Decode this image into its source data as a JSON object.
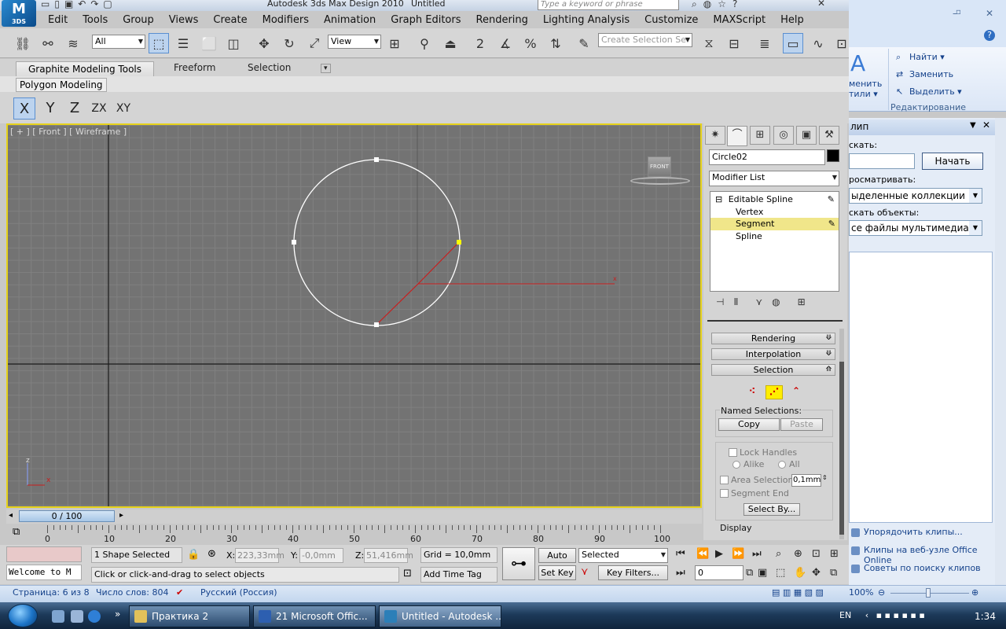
{
  "app": {
    "title": "Autodesk 3ds Max Design 2010",
    "doc_title": "Untitled",
    "logo_text": "3DS",
    "search_placeholder": "Type a keyword or phrase"
  },
  "menu": [
    "Edit",
    "Tools",
    "Group",
    "Views",
    "Create",
    "Modifiers",
    "Animation",
    "Graph Editors",
    "Rendering",
    "Lighting Analysis",
    "Customize",
    "MAXScript",
    "Help"
  ],
  "toolbar": {
    "selection_filter": "All",
    "ref_coord": "View",
    "named_selection_placeholder": "Create Selection Se"
  },
  "ribbon": {
    "tabs": [
      "Graphite Modeling Tools",
      "Freeform",
      "Selection"
    ],
    "panel_label": "Polygon Modeling",
    "axis_buttons": [
      "X",
      "Y",
      "Z",
      "ZX",
      "XY"
    ]
  },
  "viewport": {
    "label": "[ + ] [ Front ] [ Wireframe ]",
    "viewcube_label": "FRONT",
    "axis_z": "z",
    "axis_x": "x"
  },
  "command_panel": {
    "object_name": "Circle02",
    "modifier_list": "Modifier List",
    "stack": {
      "root": "Editable Spline",
      "items": [
        "Vertex",
        "Segment",
        "Spline"
      ]
    },
    "rollouts": [
      "Rendering",
      "Interpolation",
      "Selection"
    ],
    "named_selections_label": "Named Selections:",
    "copy_label": "Copy",
    "paste_label": "Paste",
    "lock_handles_label": "Lock Handles",
    "alike_label": "Alike",
    "all_label": "All",
    "area_selection_label": "Area Selection:",
    "area_selection_value": "0,1mm",
    "segment_end_label": "Segment End",
    "select_by_label": "Select By...",
    "display_label": "Display"
  },
  "timeline": {
    "slider_label": "0 / 100",
    "tick_labels": [
      "0",
      "10",
      "20",
      "30",
      "40",
      "50",
      "60",
      "70",
      "80",
      "90",
      "100"
    ]
  },
  "status": {
    "selection": "1 Shape Selected",
    "prompt": "Click or click-and-drag to select objects",
    "maxscript": "Welcome to M",
    "x_label": "X:",
    "x_value": "223,33mm",
    "y_label": "Y:",
    "y_value": "-0,0mm",
    "z_label": "Z:",
    "z_value": "51,416mm",
    "grid": "Grid = 10,0mm",
    "add_time_tag": "Add Time Tag",
    "auto_key": "Auto Key",
    "set_key": "Set Key",
    "key_mode": "Selected",
    "key_filters": "Key Filters...",
    "frame": "0"
  },
  "word": {
    "styles_lines": [
      "менить",
      "тили ▾"
    ],
    "find": "Найти ▾",
    "replace": "Заменить",
    "select": "Выделить ▾",
    "edit_group": "Редактирование",
    "clip_title": "лип",
    "search_label": "скать:",
    "go_button": "Начать",
    "browse_label": "росматривать:",
    "browse_value": "ыделенные коллекции",
    "find_objects_label": "скать объекты:",
    "find_objects_value": "се файлы мультимедиа",
    "links": [
      "Упорядочить клипы...",
      "Клипы на веб-узле Office Online",
      "Советы по поиску клипов"
    ],
    "status_page": "Страница: 6 из 8",
    "status_words": "Число слов: 804",
    "status_lang": "Русский (Россия)",
    "zoom": "100%"
  },
  "taskbar": {
    "items": [
      "Практика 2",
      "21 Microsoft Offic...",
      "Untitled - Autodesk ..."
    ],
    "lang": "EN",
    "clock": "1:34"
  },
  "colors": {
    "viewport_bg": "#737373",
    "viewport_border": "#e6d21a",
    "spline": "#ffffff",
    "segment_red": "#c81e1e",
    "selected_vertex": "#ffff00"
  }
}
